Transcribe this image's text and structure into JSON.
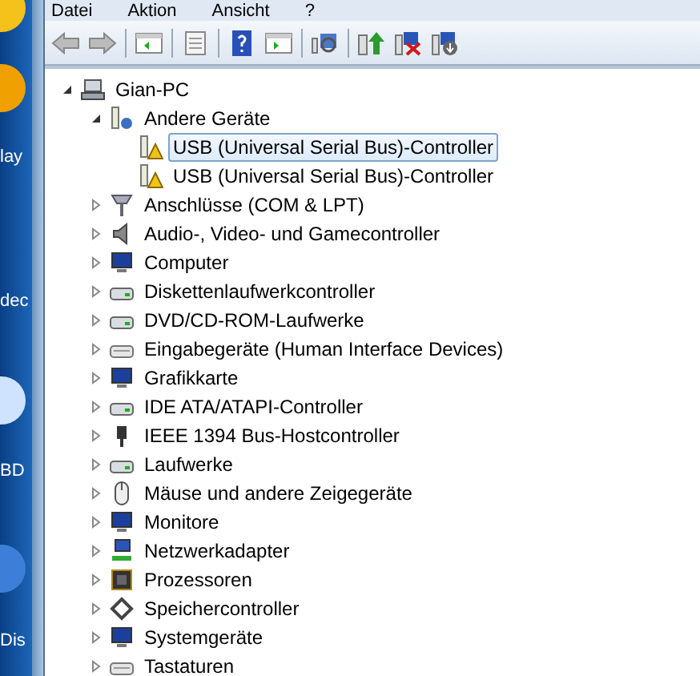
{
  "menu": [
    "Datei",
    "Aktion",
    "Ansicht",
    "?"
  ],
  "desktop_labels": [
    "lay",
    "dec",
    "BD",
    "Dis"
  ],
  "tree": [
    {
      "label": "Gian-PC",
      "expanded": true,
      "selected": false,
      "children": [
        {
          "label": "Andere Geräte",
          "expanded": true,
          "selected": false,
          "children": [
            {
              "label": "USB (Universal Serial Bus)-Controller",
              "selected": true
            },
            {
              "label": "USB (Universal Serial Bus)-Controller",
              "selected": false
            }
          ]
        },
        {
          "label": "Anschlüsse (COM & LPT)",
          "expanded": false,
          "selected": false
        },
        {
          "label": "Audio-, Video- und Gamecontroller",
          "expanded": false,
          "selected": false
        },
        {
          "label": "Computer",
          "expanded": false,
          "selected": false
        },
        {
          "label": "Diskettenlaufwerkcontroller",
          "expanded": false,
          "selected": false
        },
        {
          "label": "DVD/CD-ROM-Laufwerke",
          "expanded": false,
          "selected": false
        },
        {
          "label": "Eingabegeräte (Human Interface Devices)",
          "expanded": false,
          "selected": false
        },
        {
          "label": "Grafikkarte",
          "expanded": false,
          "selected": false
        },
        {
          "label": "IDE ATA/ATAPI-Controller",
          "expanded": false,
          "selected": false
        },
        {
          "label": "IEEE 1394 Bus-Hostcontroller",
          "expanded": false,
          "selected": false
        },
        {
          "label": "Laufwerke",
          "expanded": false,
          "selected": false
        },
        {
          "label": "Mäuse und andere Zeigegeräte",
          "expanded": false,
          "selected": false
        },
        {
          "label": "Monitore",
          "expanded": false,
          "selected": false
        },
        {
          "label": "Netzwerkadapter",
          "expanded": false,
          "selected": false
        },
        {
          "label": "Prozessoren",
          "expanded": false,
          "selected": false
        },
        {
          "label": "Speichercontroller",
          "expanded": false,
          "selected": false
        },
        {
          "label": "Systemgeräte",
          "expanded": false,
          "selected": false
        },
        {
          "label": "Tastaturen",
          "expanded": false,
          "selected": false
        }
      ]
    }
  ]
}
